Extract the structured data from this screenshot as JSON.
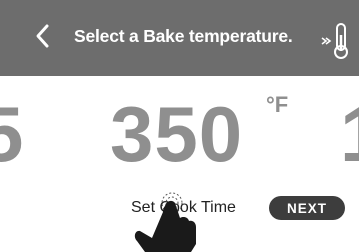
{
  "header": {
    "back_icon": "chevron-left-icon",
    "title": "Select a Bake temperature.",
    "probe_icon": "temperature-probe-icon"
  },
  "temperature": {
    "previous_partial": "5",
    "current": "350",
    "unit": "°F",
    "next_partial": "1"
  },
  "actions": {
    "cook_time_label": "Set Cook Time",
    "next_label": "NEXT"
  },
  "overlay": {
    "pointer_icon": "tapping-hand-icon"
  },
  "colors": {
    "header_bg": "#6d6d6d",
    "temperature_text": "#8f8f8f",
    "next_button_bg": "#3d3d3d",
    "background": "#ffffff"
  }
}
